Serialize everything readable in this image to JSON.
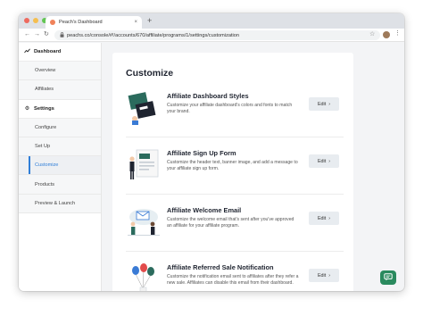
{
  "browser": {
    "tab_title": "Peach's Dashboard",
    "tab_close": "×",
    "new_tab": "+",
    "url": "peachs.co/console/#!/accounts/670/affiliate/programs/1/settings/customization",
    "back": "←",
    "forward": "→",
    "reload": "↻",
    "lock": "🔒",
    "star": "☆",
    "menu": "⋮",
    "traffic_lights": [
      "#ee6a5f",
      "#f5be4f",
      "#62c554"
    ]
  },
  "sidebar": {
    "sections": [
      {
        "label": "Dashboard",
        "icon": "chart-icon",
        "glyph": "∿",
        "items": [
          {
            "label": "Overview"
          },
          {
            "label": "Affiliates"
          }
        ]
      },
      {
        "label": "Settings",
        "icon": "gear-icon",
        "glyph": "⚙",
        "items": [
          {
            "label": "Configure"
          },
          {
            "label": "Set Up"
          },
          {
            "label": "Customize",
            "active": true
          },
          {
            "label": "Products"
          },
          {
            "label": "Preview & Launch"
          }
        ]
      }
    ]
  },
  "main": {
    "title": "Customize",
    "edit_label": "Edit",
    "edit_chevron": "›",
    "rows": [
      {
        "title": "Affiliate Dashboard Styles",
        "description": "Customize your affiliate dashboard's colors and fonts to match your brand."
      },
      {
        "title": "Affiliate Sign Up Form",
        "description": "Customize the header text, banner image, and add a message to your affiliate sign up form."
      },
      {
        "title": "Affiliate Welcome Email",
        "description": "Customize the welcome email that's sent after you've approved an affiliate for your affiliate program."
      },
      {
        "title": "Affiliate Referred Sale Notification",
        "description": "Customize the notification email sent to affiliates after they refer a new sale. Affiliates can disable this email from their dashboard."
      }
    ]
  },
  "colors": {
    "accent": "#2f7ed8",
    "brand_green": "#2a8a5e",
    "chrome": "#dee1e6"
  }
}
